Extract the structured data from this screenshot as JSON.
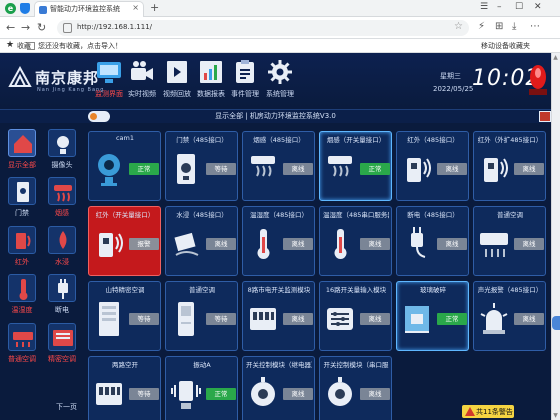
{
  "browser": {
    "tab_title": "智能动力环境监控系统",
    "url": "http://192.168.1.111/",
    "bookmarks_label": "收藏",
    "bookmarks_hint": "您还没有收藏，点击导入！",
    "mobile_bookmarks": "移动设备收藏夹"
  },
  "brand": {
    "name": "南京康邦",
    "subtitle": "Nan Jing Kang Bang"
  },
  "topnav": [
    {
      "label": "监测界面",
      "icon": "monitor-icon",
      "active": true
    },
    {
      "label": "实时视频",
      "icon": "video-camera-icon",
      "active": false
    },
    {
      "label": "视频回放",
      "icon": "film-icon",
      "active": false
    },
    {
      "label": "数据报表",
      "icon": "report-chart-icon",
      "active": false
    },
    {
      "label": "事件管理",
      "icon": "clipboard-icon",
      "active": false
    },
    {
      "label": "系统管理",
      "icon": "gear-icon",
      "active": false
    }
  ],
  "clock": {
    "weekday": "星期三",
    "date": "2022/05/25",
    "time": "10:02"
  },
  "breadcrumb": "显示全部 | 机房动力环境监控系统V3.0",
  "categories": [
    {
      "label": "显示全部",
      "icon": "home-icon",
      "active": true
    },
    {
      "label": "摄像头",
      "icon": "camera-icon",
      "active": false
    },
    {
      "label": "门禁",
      "icon": "door-access-icon",
      "active": false
    },
    {
      "label": "烟感",
      "icon": "smoke-detector-icon",
      "active": false
    },
    {
      "label": "红外",
      "icon": "infrared-icon",
      "active": false
    },
    {
      "label": "水浸",
      "icon": "water-leak-icon",
      "active": false
    },
    {
      "label": "温湿度",
      "icon": "thermometer-icon",
      "active": false
    },
    {
      "label": "断电",
      "icon": "power-plug-icon",
      "active": false
    },
    {
      "label": "普通空调",
      "icon": "air-conditioner-icon",
      "active": false
    },
    {
      "label": "精密空调",
      "icon": "precision-ac-icon",
      "active": false
    }
  ],
  "more_label": "下一页",
  "devices": [
    {
      "name": "cam1",
      "status": "正常",
      "kind": "ok",
      "icon": "webcam-icon"
    },
    {
      "name": "门禁（485接口）",
      "status": "等待",
      "kind": "wait",
      "icon": "door-lock-icon"
    },
    {
      "name": "烟感（485接口）",
      "status": "离线",
      "kind": "off",
      "icon": "smoke-detector-icon"
    },
    {
      "name": "烟感（开关量接口）",
      "status": "正常",
      "kind": "ok",
      "icon": "smoke-detector-icon"
    },
    {
      "name": "红外（485接口）",
      "status": "离线",
      "kind": "off",
      "icon": "infrared-sensor-icon"
    },
    {
      "name": "红外（外扩485接口）",
      "status": "离线",
      "kind": "off",
      "icon": "infrared-sensor-icon"
    },
    {
      "name": "红外（开关量接口）",
      "status": "报警",
      "kind": "alarm",
      "icon": "infrared-sensor-icon"
    },
    {
      "name": "水浸（485接口）",
      "status": "离线",
      "kind": "off",
      "icon": "water-leak-icon"
    },
    {
      "name": "温湿度（485接口）",
      "status": "离线",
      "kind": "off",
      "icon": "thermometer-icon"
    },
    {
      "name": "温湿度（485串口服务器",
      "status": "离线",
      "kind": "off",
      "icon": "thermometer-icon"
    },
    {
      "name": "断电（485接口）",
      "status": "离线",
      "kind": "off",
      "icon": "power-plug-icon"
    },
    {
      "name": "普通空调",
      "status": "离线",
      "kind": "off",
      "icon": "air-conditioner-icon"
    },
    {
      "name": "山特精密空调",
      "status": "等待",
      "kind": "wait",
      "icon": "precision-ac-icon"
    },
    {
      "name": "普通空调",
      "status": "等待",
      "kind": "wait",
      "icon": "floor-ac-icon"
    },
    {
      "name": "8路市电开关监测模块",
      "status": "离线",
      "kind": "off",
      "icon": "breaker-icon"
    },
    {
      "name": "16路开关量输入模块",
      "status": "离线",
      "kind": "off",
      "icon": "io-module-icon"
    },
    {
      "name": "玻璃破碎",
      "status": "正常",
      "kind": "ok",
      "icon": "glass-break-icon"
    },
    {
      "name": "声光报警（485接口）",
      "status": "离线",
      "kind": "off",
      "icon": "siren-icon"
    },
    {
      "name": "两路空开",
      "status": "等待",
      "kind": "wait",
      "icon": "breaker-icon"
    },
    {
      "name": "振动A",
      "status": "正常",
      "kind": "ok",
      "icon": "vibration-sensor-icon"
    },
    {
      "name": "开关控制模块（继电器）",
      "status": "离线",
      "kind": "off",
      "icon": "relay-fan-icon"
    },
    {
      "name": "开关控制模块（串口服",
      "status": "离线",
      "kind": "off",
      "icon": "relay-fan-icon"
    }
  ],
  "alarm_count": "共11条警告",
  "colors": {
    "background": "#0a1b3d",
    "ok": "#2aa84a",
    "alarm_card": "#c4191c",
    "active_nav": "#ff4a4a",
    "warn_pill": "#f5d442"
  }
}
